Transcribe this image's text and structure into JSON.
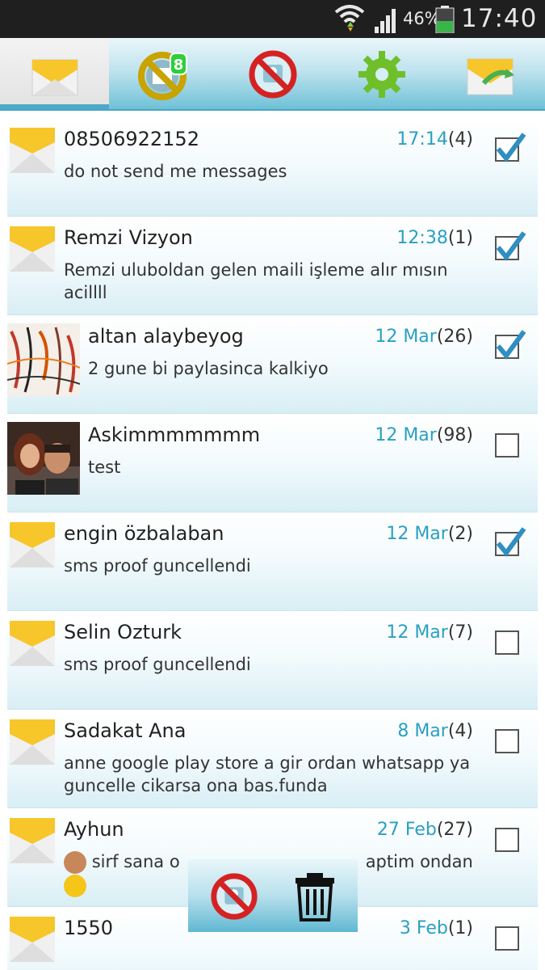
{
  "status_bar": {
    "battery_percent": "46%",
    "time": "17:40",
    "icons": [
      "wifi-icon",
      "signal-icon",
      "battery-icon"
    ]
  },
  "toolbar": {
    "tabs": [
      {
        "icon": "envelope-icon",
        "active": true
      },
      {
        "icon": "blocked-ring-icon",
        "badge": "8"
      },
      {
        "icon": "block-contact-icon"
      },
      {
        "icon": "settings-gear-icon"
      },
      {
        "icon": "envelope-refresh-icon"
      }
    ]
  },
  "messages": [
    {
      "name": "08506922152",
      "date": "17:14",
      "count": "(4)",
      "preview": "do not send me messages",
      "checked": true,
      "avatar": "envelope"
    },
    {
      "name": "Remzi Vizyon",
      "date": "12:38",
      "count": "(1)",
      "preview": "Remzi uluboldan gelen maili işleme alır mısın acillll",
      "checked": true,
      "avatar": "envelope"
    },
    {
      "name": "altan alaybeyog",
      "date": "12 Mar",
      "count": "(26)",
      "preview": "2 gune bi paylasinca kalkiyo",
      "checked": true,
      "avatar": "photo-abstract"
    },
    {
      "name": "Askimmmmmmm",
      "date": "12 Mar",
      "count": "(98)",
      "preview": "test",
      "checked": false,
      "avatar": "photo-couple"
    },
    {
      "name": "engin özbalaban",
      "date": "12 Mar",
      "count": "(2)",
      "preview": "sms proof guncellendi",
      "checked": true,
      "avatar": "envelope"
    },
    {
      "name": "Selin Ozturk",
      "date": "12 Mar",
      "count": "(7)",
      "preview": "sms proof guncellendi",
      "checked": false,
      "avatar": "envelope"
    },
    {
      "name": "Sadakat Ana",
      "date": "8 Mar",
      "count": "(4)",
      "preview": "anne google play store a gir ordan whatsapp ya guncelle cikarsa ona bas.funda",
      "checked": false,
      "avatar": "envelope"
    },
    {
      "name": "Ayhun",
      "date": "27 Feb",
      "count": "(27)",
      "preview_start": "sirf sana o",
      "preview_end": "aptim ondan",
      "checked": false,
      "avatar": "envelope"
    },
    {
      "name": "1550",
      "date": "3 Feb",
      "count": "(1)",
      "preview": "",
      "checked": false,
      "avatar": "envelope"
    }
  ],
  "action_bar": {
    "icons": [
      "block-contact-icon",
      "trash-icon"
    ]
  }
}
